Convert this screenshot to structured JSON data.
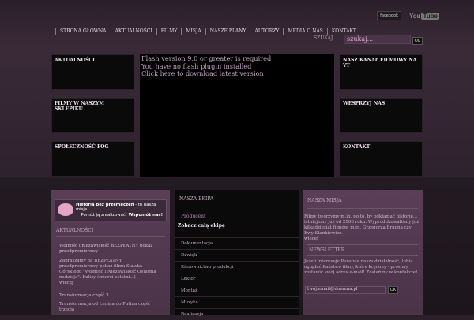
{
  "social": {
    "facebook": "facebook",
    "youtube_you": "You",
    "youtube_tube": "Tube"
  },
  "nav": [
    "STRONA GŁÓWNA",
    "AKTUALNOŚCI",
    "FILMY",
    "MISJA",
    "NASZE PLANY",
    "AUTORZY",
    "MEDIA O NAS",
    "KONTAKT"
  ],
  "search": {
    "label": "SZUKAJ",
    "value": "szukaj...",
    "ok": "OK"
  },
  "left_boxes": [
    "AKTUALNOŚCI",
    "FILMY W NASZYM SKLEPIKU",
    "SPOŁECZNOŚĆ FOG"
  ],
  "right_boxes": [
    "NASZ KANAŁ FILMOWY NA YT",
    "WESPRZYJ NAS",
    "KONTAKT"
  ],
  "flash": [
    "Flash version 9,0 or greater is required",
    "You have no flash plugin installed",
    "Click here to download latest version"
  ],
  "col1": {
    "banner1_bold": "Historia bez przemilczeń",
    "banner1_rest": " - to nasza misja.",
    "banner2_rest": "Pomóż ją zrealizować! ",
    "banner2_bold": "Wspomóż nas!",
    "header": "AKTUALNOŚCI",
    "news1_title": "Wolność i niezawisłość BEZPŁATNY pokaz przedpremierowy",
    "news1_text": "Zapraszamy na BEZPŁATNY przedpremierowy pokaz filmu Sławka Górskiego \"Wolność i Niezawisłość Ostatnia nadzieja\". Kulisy śmierci ostatni...)",
    "news1_more": "więcej",
    "news2_title": "Transformacja część 3",
    "news2_text": "Transformacja od Lenina do Putina część trzecia"
  },
  "col2": {
    "header": "NASZA EKIPA",
    "producer": "Producent",
    "see_all": "Zobacz całą ekipę",
    "items": [
      "Dokumentacja",
      "Dźwięk",
      "Kierownictwo produkcji",
      "Lektor",
      "Montaż",
      "Muzyka",
      "Realizacja"
    ]
  },
  "col3": {
    "header": "NASZA MISJA",
    "mission": "Filmy tworzymy m.in. po to, by odkłamać historię... istniejemy już od 2006 roku. Wyprodukowaliśmy już kilkadziesiąt filmów, m.in. Grzegorza Brauna czy Ewy Stankiewicz.",
    "more": "więcej",
    "newsletter_header": "NEWSLETTER",
    "newsletter_text": "Jeżeli interesuje Państwa nasza działalność, lubią oglądać Państwo filmy, które kręcimy - prosimy zostawić swój adres e-mail! Zostańmy w kontakcie!",
    "email_value": "twoj.email@domena.pl",
    "ok": "OK"
  }
}
